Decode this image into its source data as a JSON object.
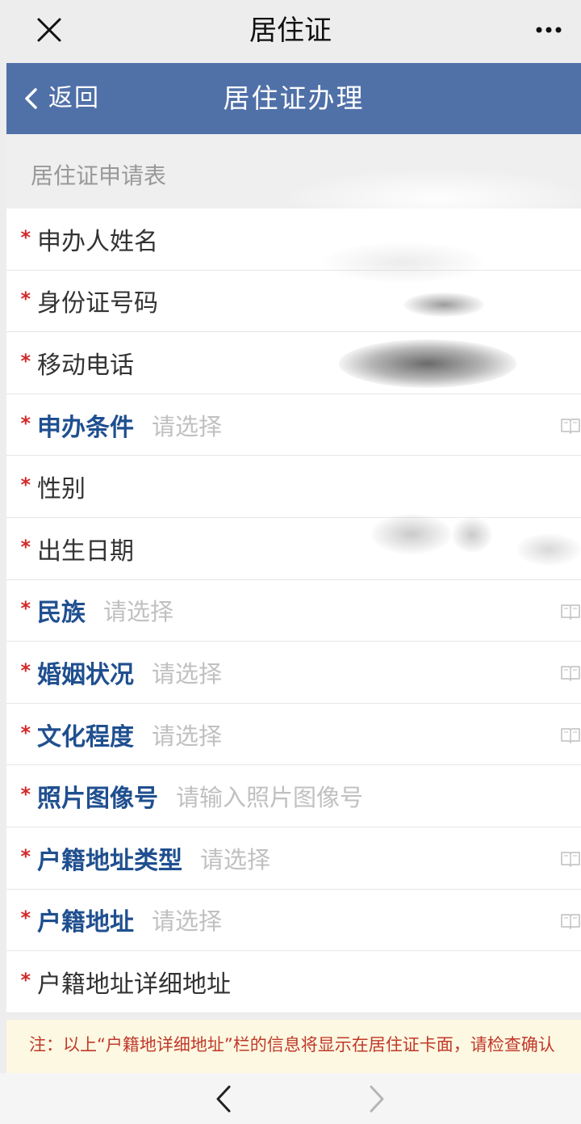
{
  "topbar": {
    "title": "居住证"
  },
  "header": {
    "back_label": "返回",
    "title": "居住证办理"
  },
  "section": {
    "title": "居住证申请表"
  },
  "fields": [
    {
      "label": "申办人姓名",
      "placeholder": "",
      "selectable": false,
      "required": true
    },
    {
      "label": "身份证号码",
      "placeholder": "",
      "selectable": false,
      "required": true
    },
    {
      "label": "移动电话",
      "placeholder": "",
      "selectable": false,
      "required": true
    },
    {
      "label": "申办条件",
      "placeholder": "请选择",
      "selectable": true,
      "required": true
    },
    {
      "label": "性别",
      "placeholder": "",
      "selectable": false,
      "required": true
    },
    {
      "label": "出生日期",
      "placeholder": "",
      "selectable": false,
      "required": true
    },
    {
      "label": "民族",
      "placeholder": "请选择",
      "selectable": true,
      "required": true
    },
    {
      "label": "婚姻状况",
      "placeholder": "请选择",
      "selectable": true,
      "required": true
    },
    {
      "label": "文化程度",
      "placeholder": "请选择",
      "selectable": true,
      "required": true
    },
    {
      "label": "照片图像号",
      "placeholder": "请输入照片图像号",
      "selectable": false,
      "required": true
    },
    {
      "label": "户籍地址类型",
      "placeholder": "请选择",
      "selectable": true,
      "required": true
    },
    {
      "label": "户籍地址",
      "placeholder": "请选择",
      "selectable": true,
      "required": true
    },
    {
      "label": "户籍地址详细地址",
      "placeholder": "",
      "selectable": false,
      "required": true
    }
  ],
  "note": {
    "text": "注：以上“户籍地详细地址”栏的信息将显示在居住证卡面，请检查确认"
  },
  "colors": {
    "header_bg": "#5070a8",
    "label_blue": "#1f4f8f",
    "required_star": "#d22a2a",
    "note_text": "#c0392b"
  },
  "icons": {
    "close": "close-icon",
    "more": "more-icon",
    "back": "chevron-left-icon",
    "picker": "book-icon",
    "nav_prev": "chevron-left-icon",
    "nav_next": "chevron-right-icon"
  }
}
